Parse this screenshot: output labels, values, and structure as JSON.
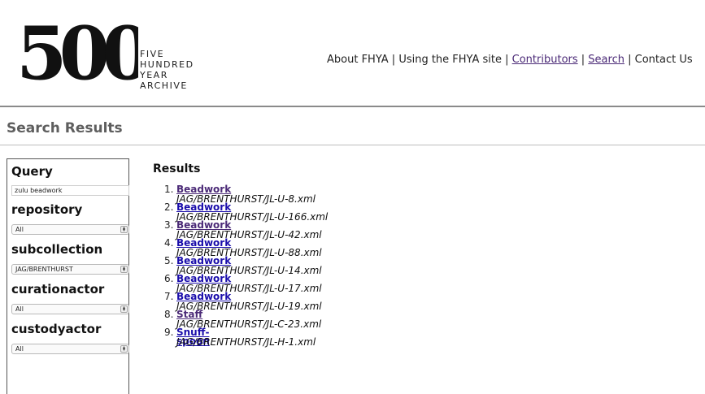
{
  "logo": {
    "number": "500",
    "lines": [
      "FIVE",
      "HUNDRED",
      "YEAR",
      "ARCHIVE"
    ]
  },
  "nav": {
    "items": [
      {
        "label": "About FHYA",
        "link": false
      },
      {
        "label": "Using the FHYA site",
        "link": false
      },
      {
        "label": "Contributors",
        "link": true
      },
      {
        "label": "Search",
        "link": true
      },
      {
        "label": "Contact Us",
        "link": false
      }
    ],
    "separator": " | "
  },
  "page": {
    "title": "Search Results"
  },
  "sidebar": {
    "query_heading": "Query",
    "query_value": "zulu beadwork",
    "filters": [
      {
        "label": "repository",
        "selected": "All"
      },
      {
        "label": "subcollection",
        "selected": "JAG/BRENTHURST"
      },
      {
        "label": "curationactor",
        "selected": "All"
      },
      {
        "label": "custodyactor",
        "selected": "All"
      }
    ]
  },
  "results": {
    "heading": "Results",
    "items": [
      {
        "num": "1.",
        "title": "Beadwork",
        "path": "JAG/BRENTHURST/JL-U-8.xml",
        "visited": true
      },
      {
        "num": "2.",
        "title": "Beadwork",
        "path": "JAG/BRENTHURST/JL-U-166.xml",
        "visited": false
      },
      {
        "num": "3.",
        "title": "Beadwork",
        "path": "JAG/BRENTHURST/JL-U-42.xml",
        "visited": true
      },
      {
        "num": "4.",
        "title": "Beadwork",
        "path": "JAG/BRENTHURST/JL-U-88.xml",
        "visited": false
      },
      {
        "num": "5.",
        "title": "Beadwork",
        "path": "JAG/BRENTHURST/JL-U-14.xml",
        "visited": false
      },
      {
        "num": "6.",
        "title": "Beadwork",
        "path": "JAG/BRENTHURST/JL-U-17.xml",
        "visited": false
      },
      {
        "num": "7.",
        "title": "Beadwork",
        "path": "JAG/BRENTHURST/JL-U-19.xml",
        "visited": false
      },
      {
        "num": "8.",
        "title": "Staff",
        "path": "JAG/BRENTHURST/JL-C-23.xml",
        "visited": true
      },
      {
        "num": "9.",
        "title": "Snuff-spoon",
        "path": "JAG/BRENTHURST/JL-H-1.xml",
        "visited": false
      }
    ]
  },
  "colors": {
    "link": "#1a0dab",
    "visited": "#4b2a77",
    "heading_gray": "#5e5e5e"
  }
}
